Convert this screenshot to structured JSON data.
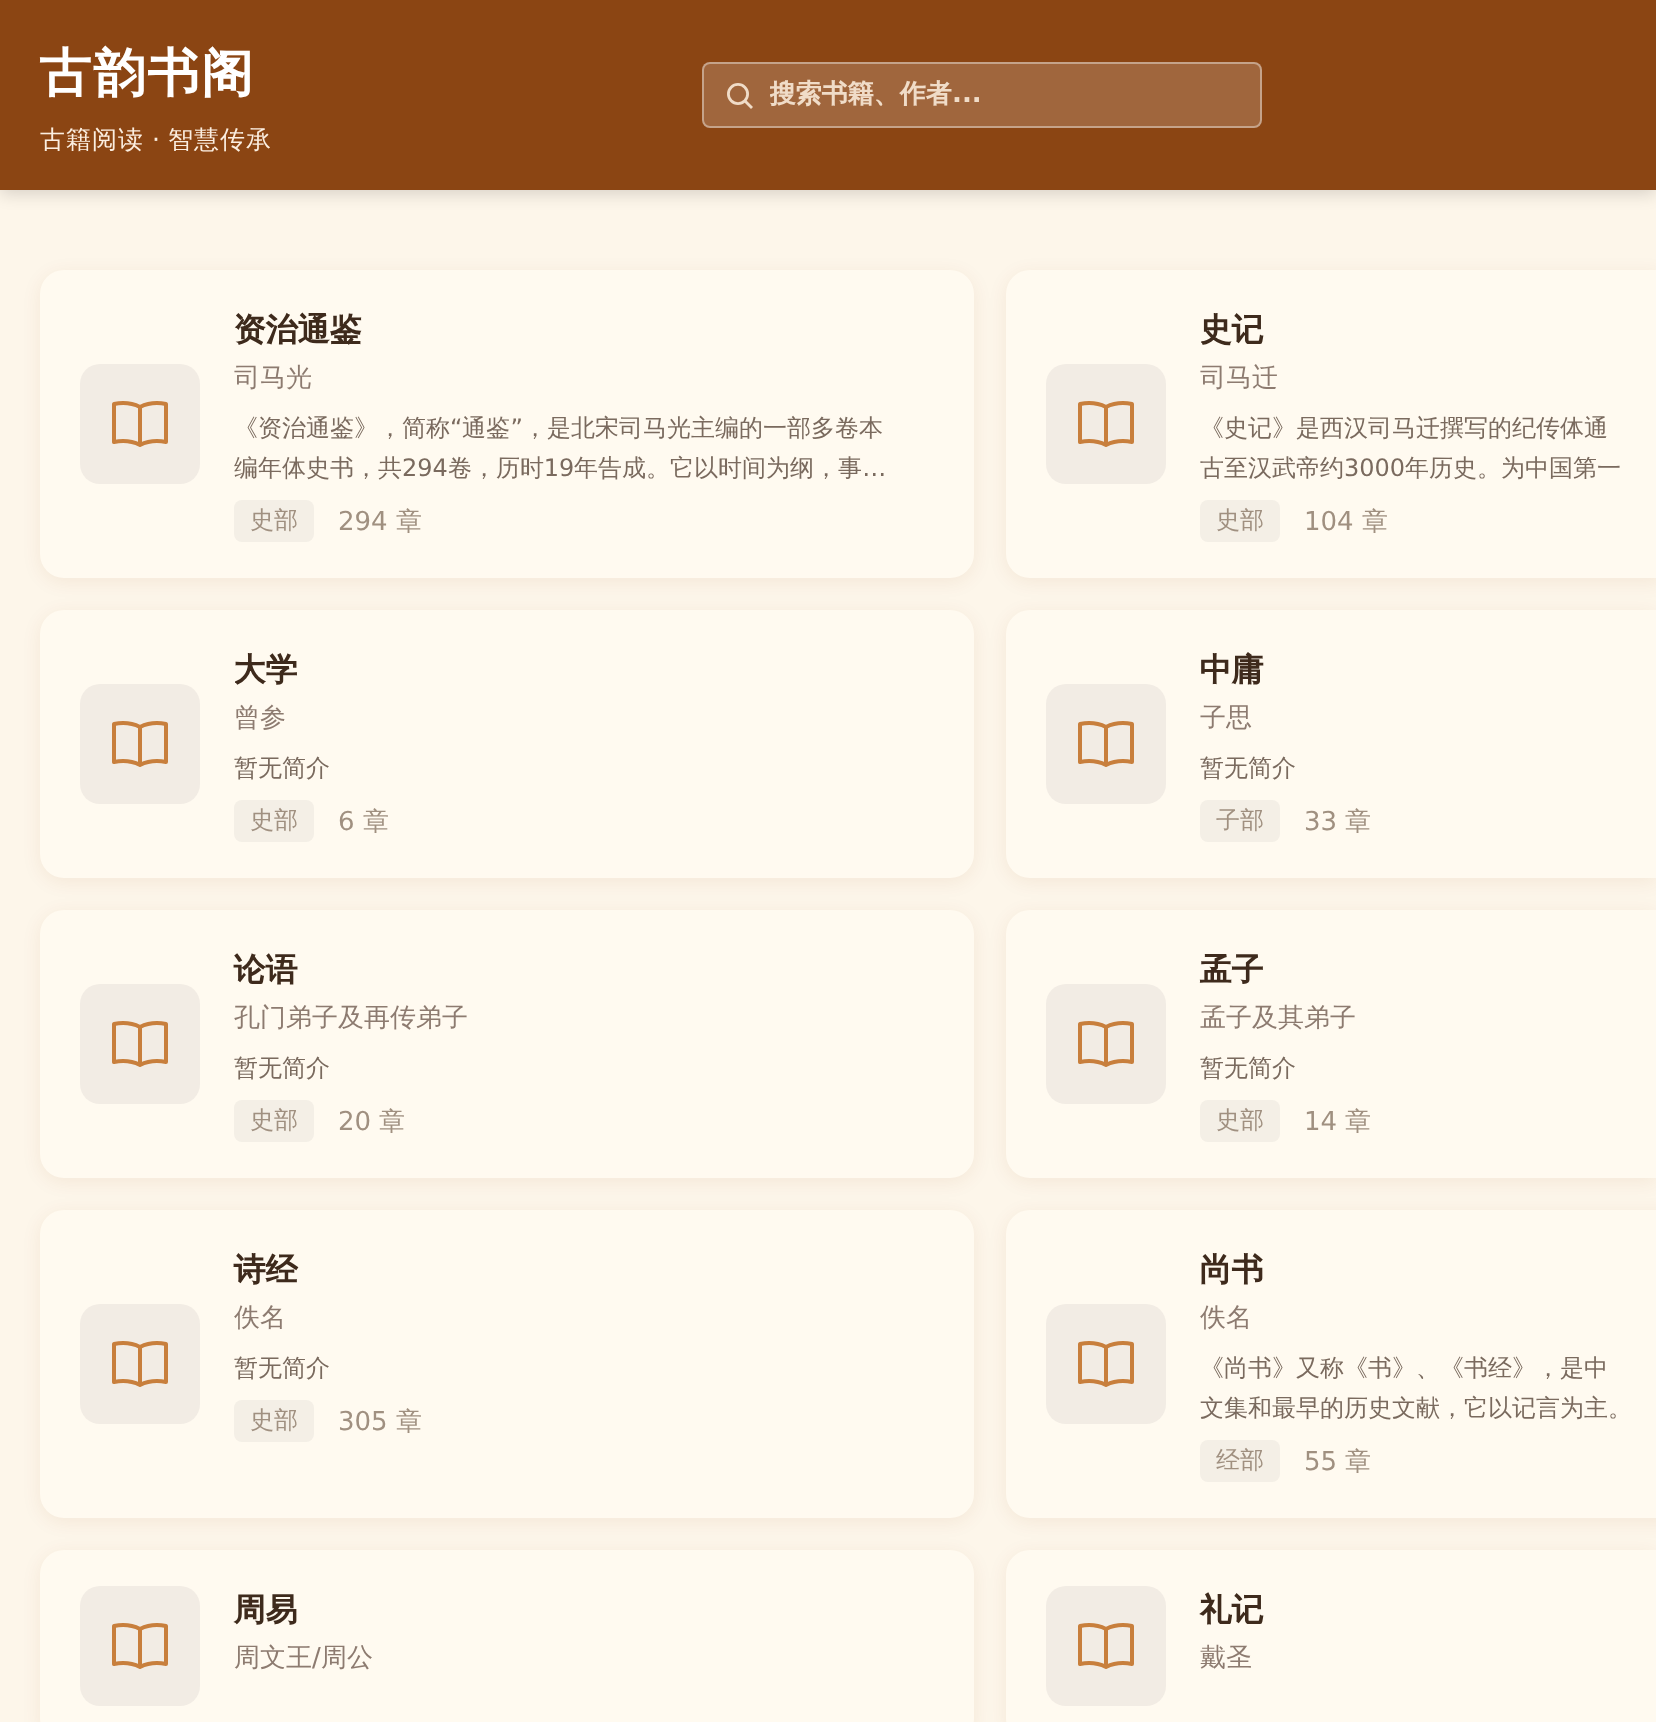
{
  "header": {
    "title": "古韵书阁",
    "subtitle": "古籍阅读 · 智慧传承"
  },
  "search": {
    "placeholder": "搜索书籍、作者..."
  },
  "books": [
    {
      "title": "资治通鉴",
      "author": "司马光",
      "description": [
        "《资治通鉴》，简称“通鉴”，是北宋司马光主编的一部多卷本",
        "编年体史书，共294卷，历时19年告成。它以时间为纲，事…"
      ],
      "category": "史部",
      "chapters": "294 章"
    },
    {
      "title": "史记",
      "author": "司马迁",
      "description": [
        "《史记》是西汉司马迁撰写的纪传体通",
        "古至汉武帝约3000年历史。为中国第一"
      ],
      "category": "史部",
      "chapters": "104 章"
    },
    {
      "title": "大学",
      "author": "曾参",
      "description": [
        "暂无简介"
      ],
      "category": "史部",
      "chapters": "6 章"
    },
    {
      "title": "中庸",
      "author": "子思",
      "description": [
        "暂无简介"
      ],
      "category": "子部",
      "chapters": "33 章"
    },
    {
      "title": "论语",
      "author": "孔门弟子及再传弟子",
      "description": [
        "暂无简介"
      ],
      "category": "史部",
      "chapters": "20 章"
    },
    {
      "title": "孟子",
      "author": "孟子及其弟子",
      "description": [
        "暂无简介"
      ],
      "category": "史部",
      "chapters": "14 章"
    },
    {
      "title": "诗经",
      "author": "佚名",
      "description": [
        "暂无简介"
      ],
      "category": "史部",
      "chapters": "305 章"
    },
    {
      "title": "尚书",
      "author": "佚名",
      "description": [
        "《尚书》又称《书》、《书经》，是中",
        "文集和最早的历史文献，它以记言为主。"
      ],
      "category": "经部",
      "chapters": "55 章"
    },
    {
      "title": "周易",
      "author": "周文王/周公"
    },
    {
      "title": "礼记",
      "author": "戴圣"
    }
  ]
}
